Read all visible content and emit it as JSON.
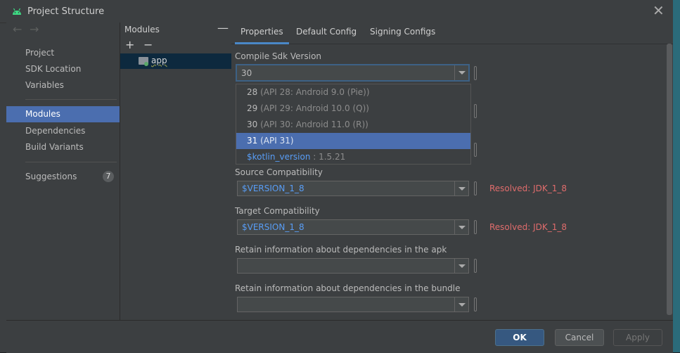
{
  "window": {
    "title": "Project Structure"
  },
  "sidebar": {
    "items": [
      {
        "label": "Project"
      },
      {
        "label": "SDK Location"
      },
      {
        "label": "Variables"
      },
      {
        "label": "Modules"
      },
      {
        "label": "Dependencies"
      },
      {
        "label": "Build Variants"
      },
      {
        "label": "Suggestions",
        "badge": "7"
      }
    ],
    "selected": "Modules"
  },
  "modules": {
    "header": "Modules",
    "items": [
      {
        "label": "app"
      }
    ]
  },
  "tabs": [
    {
      "label": "Properties",
      "active": true
    },
    {
      "label": "Default Config"
    },
    {
      "label": "Signing Configs"
    }
  ],
  "properties": {
    "compile_sdk": {
      "label": "Compile Sdk Version",
      "value": "30"
    },
    "dropdown": [
      {
        "main": "28",
        "dim": " (API 28: Android 9.0 (Pie))"
      },
      {
        "main": "29",
        "dim": " (API 29: Android 10.0 (Q))"
      },
      {
        "main": "30",
        "dim": " (API 30: Android 11.0 (R))"
      },
      {
        "main": "31",
        "dim": " (API 31)",
        "selected": true
      },
      {
        "main": "$kotlin_version",
        "dim": " : 1.5.21"
      }
    ],
    "source_compat": {
      "label": "Source Compatibility",
      "value": "$VERSION_1_8",
      "resolved": "Resolved: JDK_1_8"
    },
    "target_compat": {
      "label": "Target Compatibility",
      "value": "$VERSION_1_8",
      "resolved": "Resolved: JDK_1_8"
    },
    "deps_apk": {
      "label": "Retain information about dependencies in the apk",
      "value": ""
    },
    "deps_bundle": {
      "label": "Retain information about dependencies in the bundle",
      "value": ""
    }
  },
  "footer": {
    "ok": "OK",
    "cancel": "Cancel",
    "apply": "Apply"
  },
  "colors": {
    "accent": "#4b6eaf",
    "error": "#e06c6c",
    "variable": "#589df6",
    "android": "#3ddc84"
  },
  "icons": [
    "android-icon",
    "close-icon",
    "back-arrow-icon",
    "forward-arrow-icon",
    "add-icon",
    "remove-icon",
    "folder-module-icon",
    "chevron-down-icon"
  ]
}
